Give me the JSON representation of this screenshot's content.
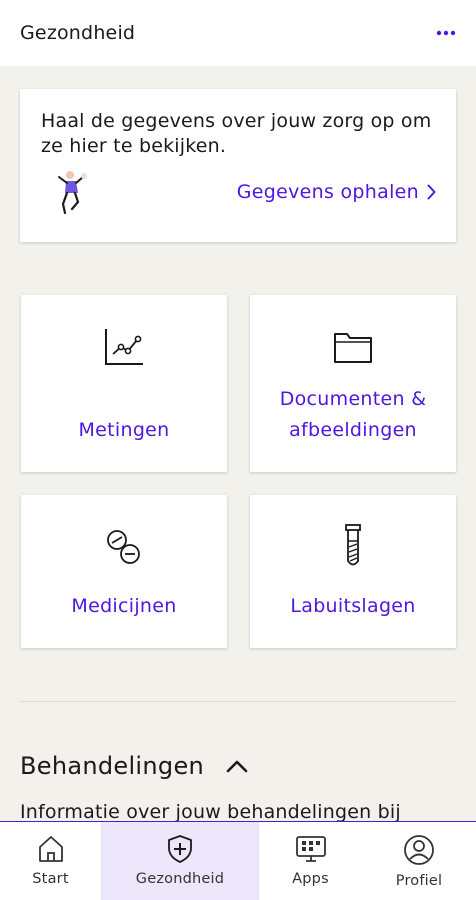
{
  "header": {
    "title": "Gezondheid",
    "more_icon": "more-horizontal-icon"
  },
  "info_card": {
    "text": "Haal de gegevens over jouw zorg op om ze hier te bekijken.",
    "link_label": "Gegevens ophalen",
    "illustration": "person-illustration"
  },
  "tiles": [
    {
      "label": "Metingen",
      "icon": "chart-line-icon"
    },
    {
      "label_line1": "Documenten &",
      "label_line2": "afbeeldingen",
      "icon": "folder-icon"
    },
    {
      "label": "Medicijnen",
      "icon": "pills-icon"
    },
    {
      "label": "Labuitslagen",
      "icon": "test-tube-icon"
    }
  ],
  "section": {
    "title": "Behandelingen",
    "description": "Informatie over jouw behandelingen bij"
  },
  "bottom_nav": [
    {
      "label": "Start",
      "icon": "home-icon"
    },
    {
      "label": "Gezondheid",
      "icon": "shield-plus-icon",
      "active": true
    },
    {
      "label": "Apps",
      "icon": "apps-icon"
    },
    {
      "label": "Profiel",
      "icon": "profile-icon"
    }
  ],
  "colors": {
    "accent": "#4b19e0",
    "background": "#f2f1ec",
    "active_nav": "#ece6fb"
  }
}
